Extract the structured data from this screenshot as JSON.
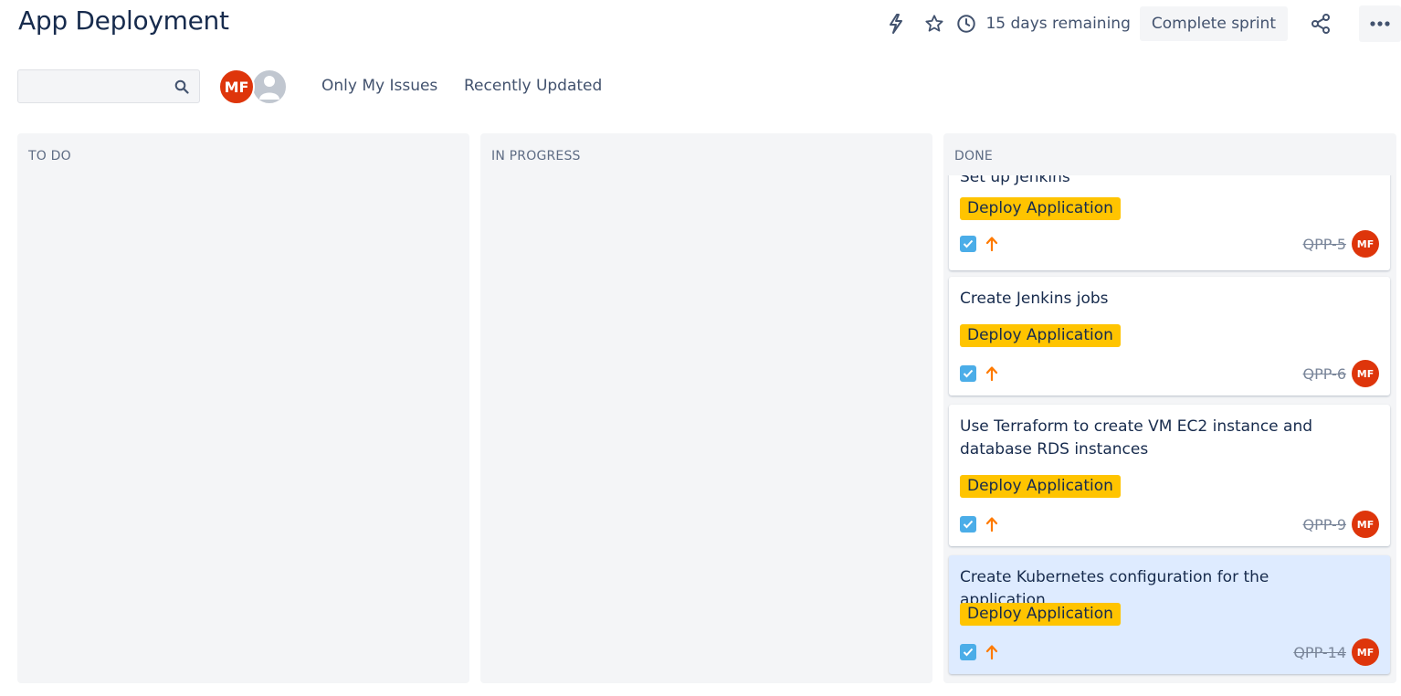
{
  "header": {
    "title": "App Deployment",
    "remaining": "15 days remaining",
    "complete_label": "Complete sprint"
  },
  "toolbar": {
    "search_value": "",
    "avatar_initials": "MF",
    "filters": [
      "Only My Issues",
      "Recently Updated"
    ]
  },
  "columns": [
    {
      "name": "TO DO"
    },
    {
      "name": "IN PROGRESS"
    },
    {
      "name": "DONE"
    }
  ],
  "cards": [
    {
      "title": "Set up Jenkins",
      "epic": "Deploy Application",
      "key": "QPP-5",
      "assignee": "MF",
      "priority": "high-arrow-up-icon",
      "type": "task-checkbox-icon"
    },
    {
      "title": "Create Jenkins jobs",
      "epic": "Deploy Application",
      "key": "QPP-6",
      "assignee": "MF",
      "priority": "high-arrow-up-icon",
      "type": "task-checkbox-icon"
    },
    {
      "title": "Use Terraform to create VM EC2 instance and database RDS instances",
      "epic": "Deploy Application",
      "key": "QPP-9",
      "assignee": "MF",
      "priority": "high-arrow-up-icon",
      "type": "task-checkbox-icon"
    },
    {
      "title": "Create Kubernetes configuration for the application",
      "epic": "Deploy Application",
      "key": "QPP-14",
      "assignee": "MF",
      "priority": "high-arrow-up-icon",
      "type": "task-checkbox-icon",
      "selected": true
    }
  ],
  "colors": {
    "epic": "#ffc400",
    "avatar": "#de350b",
    "checkbox": "#4bade8",
    "priority": "#ff7a00",
    "selected_card": "#deebff",
    "column_bg": "#f4f5f7"
  }
}
